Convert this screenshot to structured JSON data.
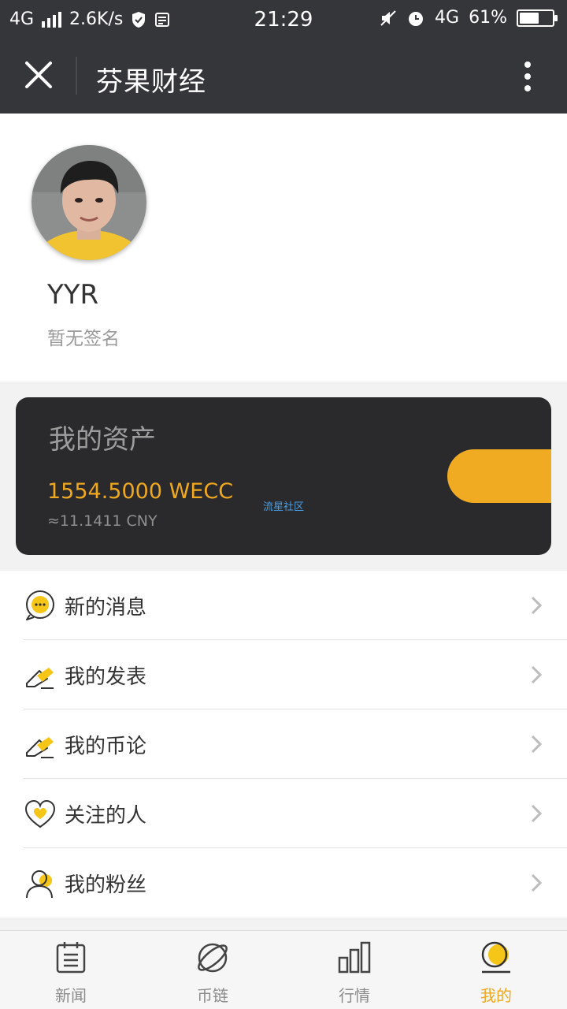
{
  "status_bar": {
    "network": "4G",
    "speed": "2.6K/s",
    "time": "21:29",
    "network_right": "4G",
    "battery": "61%",
    "battery_level": 0.61
  },
  "nav": {
    "title": "芬果财经"
  },
  "profile": {
    "username": "YYR",
    "signature": "暂无签名"
  },
  "assets": {
    "label": "我的资产",
    "amount": "1554.5000 WECC",
    "cny": "≈11.1411 CNY",
    "watermark": "流星社区"
  },
  "menu": [
    {
      "label": "新的消息",
      "icon": "message-icon"
    },
    {
      "label": "我的发表",
      "icon": "edit-icon"
    },
    {
      "label": "我的币论",
      "icon": "edit-icon"
    },
    {
      "label": "关注的人",
      "icon": "heart-icon"
    },
    {
      "label": "我的粉丝",
      "icon": "user-icon"
    }
  ],
  "tabs": [
    {
      "label": "新闻",
      "icon": "news-icon",
      "active": false
    },
    {
      "label": "币链",
      "icon": "planet-icon",
      "active": false
    },
    {
      "label": "行情",
      "icon": "bar-chart-icon",
      "active": false
    },
    {
      "label": "我的",
      "icon": "profile-icon",
      "active": true
    }
  ],
  "colors": {
    "accent": "#f0a81e",
    "dark": "#35363a",
    "card": "#2a2a2c"
  }
}
